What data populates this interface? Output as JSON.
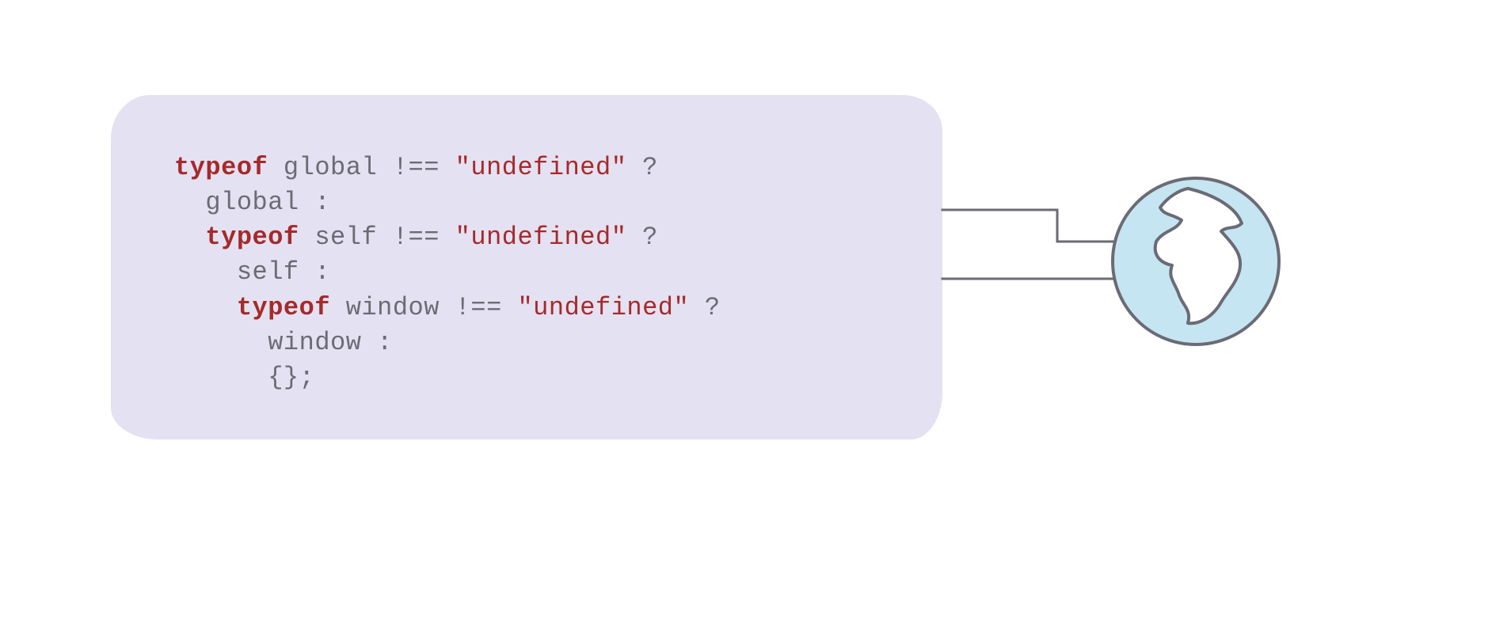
{
  "code": {
    "tokens": [
      {
        "cls": "kw",
        "text": "typeof"
      },
      {
        "cls": "plain",
        "text": " global !== "
      },
      {
        "cls": "str",
        "text": "\"undefined\""
      },
      {
        "cls": "plain",
        "text": " ?\n  global :\n  "
      },
      {
        "cls": "kw",
        "text": "typeof"
      },
      {
        "cls": "plain",
        "text": " self !== "
      },
      {
        "cls": "str",
        "text": "\"undefined\""
      },
      {
        "cls": "plain",
        "text": " ?\n    self :\n    "
      },
      {
        "cls": "kw",
        "text": "typeof"
      },
      {
        "cls": "plain",
        "text": " window !== "
      },
      {
        "cls": "str",
        "text": "\"undefined\""
      },
      {
        "cls": "plain",
        "text": " ?\n      window :\n      {};"
      }
    ]
  },
  "colors": {
    "cardBg": "#e4e1f2",
    "keyword": "#a52a2a",
    "string": "#a52a2a",
    "text": "#6b6b75",
    "connector": "#6b6b75",
    "globeFill": "#c6e5f2",
    "globeStroke": "#6b6b75"
  }
}
